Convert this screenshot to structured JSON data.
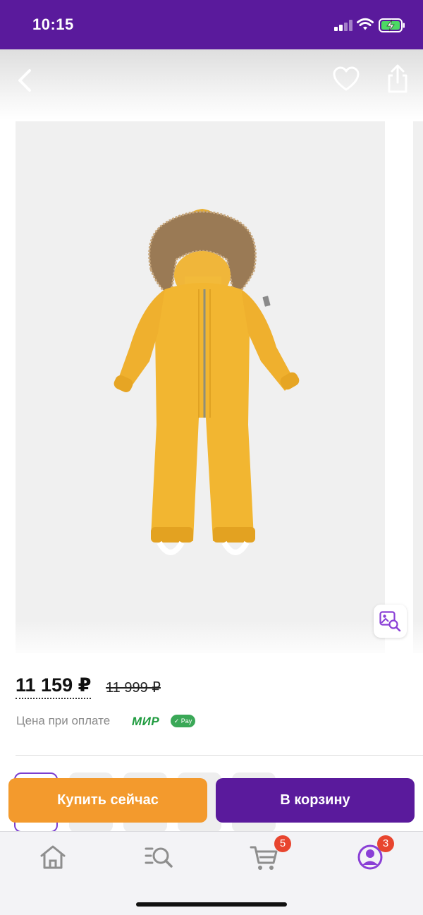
{
  "status_bar": {
    "time": "10:15",
    "icons": [
      "signal-icon",
      "wifi-icon",
      "battery-charging-icon"
    ]
  },
  "header": {
    "icons": [
      "back-arrow-icon",
      "heart-icon",
      "share-icon"
    ]
  },
  "gallery": {
    "image": "yellow-kids-winter-snowsuit",
    "visual_search_icon": "image-search-icon"
  },
  "price": {
    "current": "11 159 ₽",
    "old": "11 999 ₽",
    "note": "Цена при оплате",
    "mir_logo": "МИР",
    "mirpay_badge": "Pay"
  },
  "actions": {
    "buy_now": "Купить сейчас",
    "add_to_cart": "В корзину"
  },
  "tab_bar": {
    "tabs": [
      {
        "name": "home",
        "icon": "home-icon"
      },
      {
        "name": "catalog",
        "icon": "catalog-search-icon"
      },
      {
        "name": "cart",
        "icon": "cart-icon",
        "badge": "5"
      },
      {
        "name": "profile",
        "icon": "profile-icon",
        "badge": "3"
      }
    ]
  },
  "colors": {
    "brand_purple": "#5a1a9c",
    "buy_orange": "#f39a2d",
    "badge_red": "#e8452f",
    "mir_green": "#1f9b3f"
  }
}
